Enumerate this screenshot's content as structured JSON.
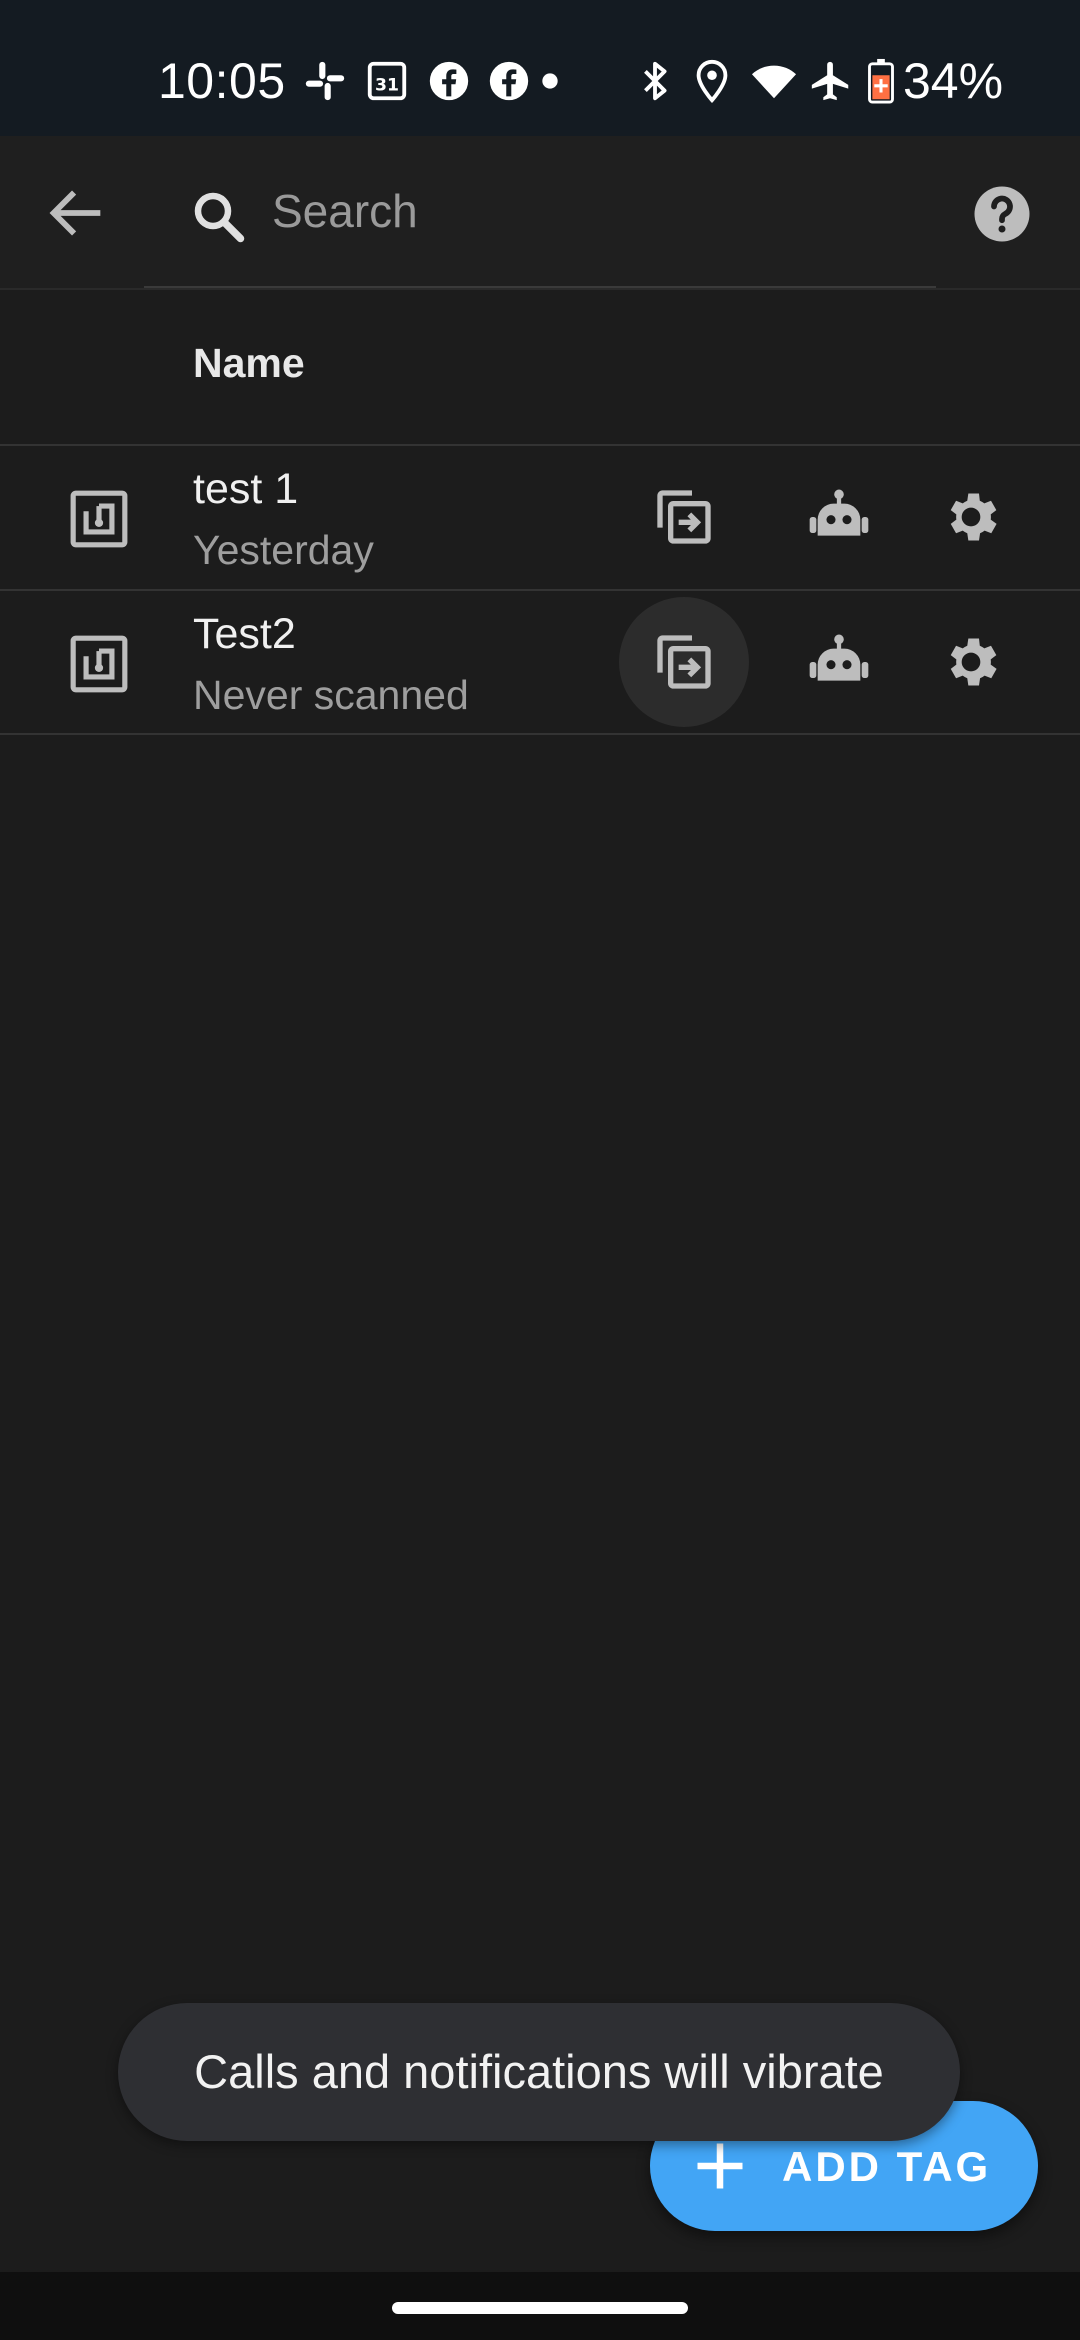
{
  "status_bar": {
    "time": "10:05",
    "battery": "34%",
    "icons": [
      "slack-icon",
      "calendar-icon",
      "facebook-icon",
      "facebook-icon",
      "dot-icon",
      "bluetooth-icon",
      "location-icon",
      "wifi-icon",
      "airplane-icon",
      "battery-icon"
    ],
    "calendar_day": "31",
    "battery_color": "#ff7043"
  },
  "app_bar": {
    "back_icon": "arrow-left-icon",
    "search_placeholder": "Search",
    "search_value": "",
    "help_icon": "help-circle-icon"
  },
  "table": {
    "header_name": "Name",
    "rows": [
      {
        "name": "test 1",
        "subtitle": "Yesterday",
        "icon": "nfc-tag-icon",
        "actions": [
          "copy-icon",
          "robot-icon",
          "gear-icon"
        ]
      },
      {
        "name": "Test2",
        "subtitle": "Never scanned",
        "icon": "nfc-tag-icon",
        "actions": [
          "copy-icon",
          "robot-icon",
          "gear-icon"
        ]
      }
    ]
  },
  "toast": {
    "text": "Calls and notifications will vibrate"
  },
  "fab": {
    "label": "ADD TAG",
    "icon": "plus-icon",
    "color": "#42a5f5"
  },
  "colors": {
    "background": "#1c1c1c",
    "status_bar": "#141b22",
    "icon_gray": "#bdbdbd"
  }
}
